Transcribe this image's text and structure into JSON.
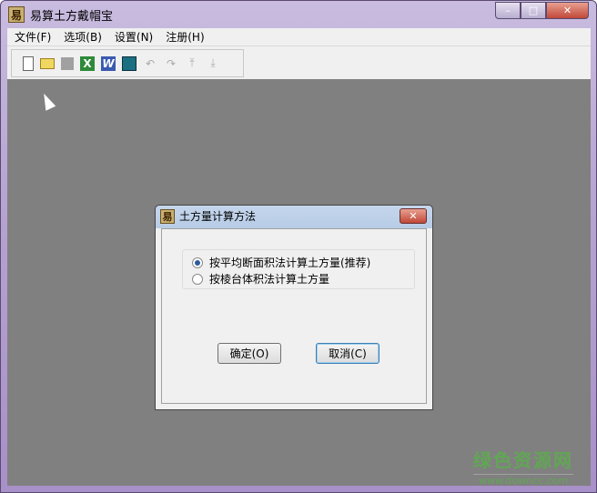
{
  "window": {
    "title": "易算土方戴帽宝",
    "icon_text": "易",
    "min": "–",
    "max": "□",
    "close": "✕"
  },
  "menu": [
    "文件(F)",
    "选项(B)",
    "设置(N)",
    "注册(H)"
  ],
  "toolbar": [
    "new-file",
    "open-folder",
    "save",
    "excel",
    "word",
    "calculator",
    "undo",
    "redo",
    "move-up",
    "move-down"
  ],
  "dialog": {
    "title": "土方量计算方法",
    "close": "✕",
    "options": [
      {
        "label": "按平均断面积法计算土方量(推荐)",
        "selected": true
      },
      {
        "label": "按棱台体积法计算土方量",
        "selected": false
      }
    ],
    "ok": "确定(O)",
    "cancel": "取消(C)"
  },
  "watermark": {
    "line1": "绿色资源网",
    "line2": "www.downcc.com"
  }
}
